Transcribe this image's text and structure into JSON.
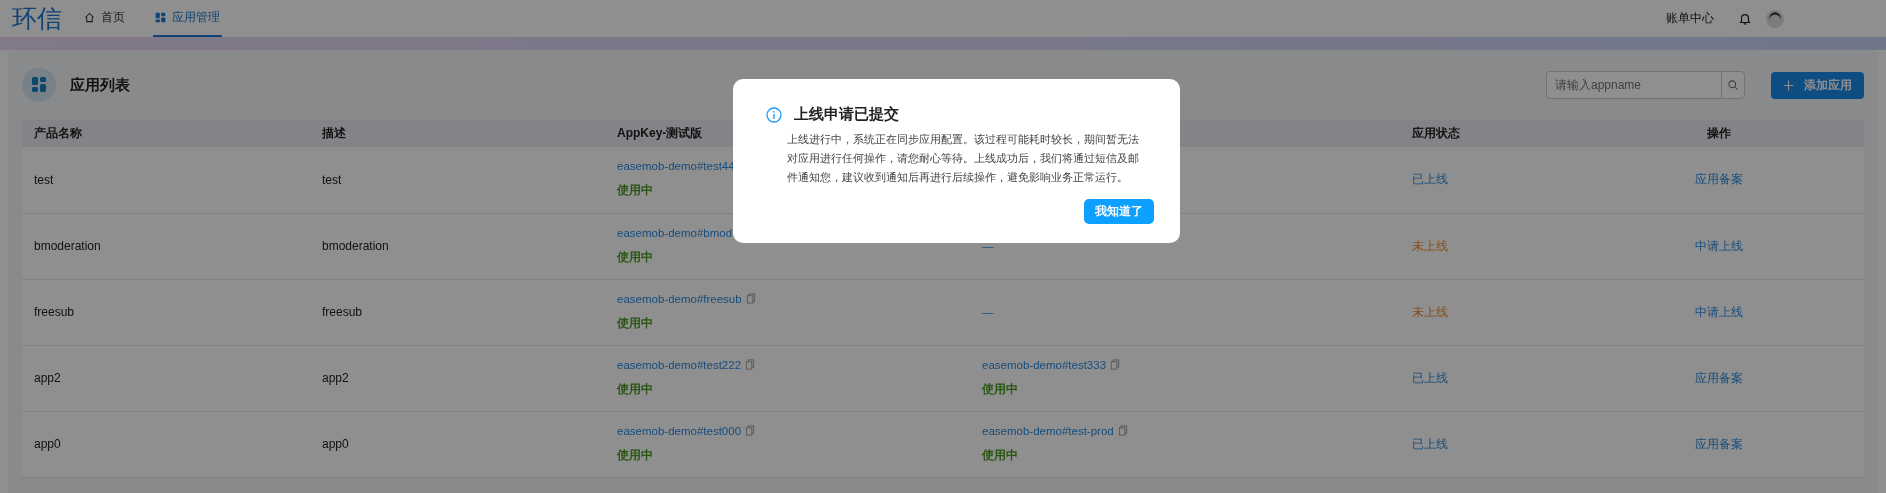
{
  "header": {
    "logo": "环信",
    "nav": [
      {
        "label": "首页",
        "selected": false
      },
      {
        "label": "应用管理",
        "selected": true
      }
    ],
    "billing": "账单中心"
  },
  "page": {
    "title": "应用列表",
    "search": {
      "placeholder": "请输入appname"
    },
    "add_button": "添加应用"
  },
  "table": {
    "columns": [
      {
        "label": "产品名称"
      },
      {
        "label": "描述"
      },
      {
        "label": "AppKey-测试版"
      },
      {},
      {
        "label": "应用状态"
      },
      {
        "label": "操作"
      }
    ],
    "rows": [
      {
        "name": "test",
        "description": "test",
        "appkey_test": {
          "key": "easemob-demo#test44",
          "status": "使用中"
        },
        "state": {
          "label": "已上线",
          "kind": "online"
        },
        "action": "应用备案"
      },
      {
        "name": "bmoderation",
        "description": "bmoderation",
        "appkey_test": {
          "key": "easemob-demo#bmod",
          "status": "使用中"
        },
        "appkey_prod": {
          "key": "—"
        },
        "state": {
          "label": "未上线",
          "kind": "offline"
        },
        "action": "中请上线"
      },
      {
        "name": "freesub",
        "description": "freesub",
        "appkey_test": {
          "key": "easemob-demo#freesub",
          "copy_icon": true,
          "status": "使用中"
        },
        "appkey_prod": {
          "key": "—"
        },
        "state": {
          "label": "未上线",
          "kind": "offline"
        },
        "action": "中请上线"
      },
      {
        "name": "app2",
        "description": "app2",
        "appkey_test": {
          "key": "easemob-demo#test222",
          "copy_icon": true,
          "status": "使用中"
        },
        "appkey_prod": {
          "key": "easemob-demo#test333",
          "copy_icon": true,
          "status": "使用中"
        },
        "state": {
          "label": "已上线",
          "kind": "online"
        },
        "action": "应用备案"
      },
      {
        "name": "app0",
        "description": "app0",
        "appkey_test": {
          "key": "easemob-demo#test000",
          "copy_icon": true,
          "status": "使用中"
        },
        "appkey_prod": {
          "key": "easemob-demo#test-prod",
          "copy_icon": true,
          "status": "使用中"
        },
        "state": {
          "label": "已上线",
          "kind": "online"
        },
        "action": "应用备案"
      }
    ]
  },
  "modal": {
    "title": "上线申请已提交",
    "body": "上线进行中，系统正在同步应用配置。该过程可能耗时较长，期间暂无法对应用进行任何操作，请您耐心等待。上线成功后，我们将通过短信及邮件通知您，建议收到通知后再进行后续操作，避免影响业务正常运行。",
    "button": "我知道了"
  }
}
